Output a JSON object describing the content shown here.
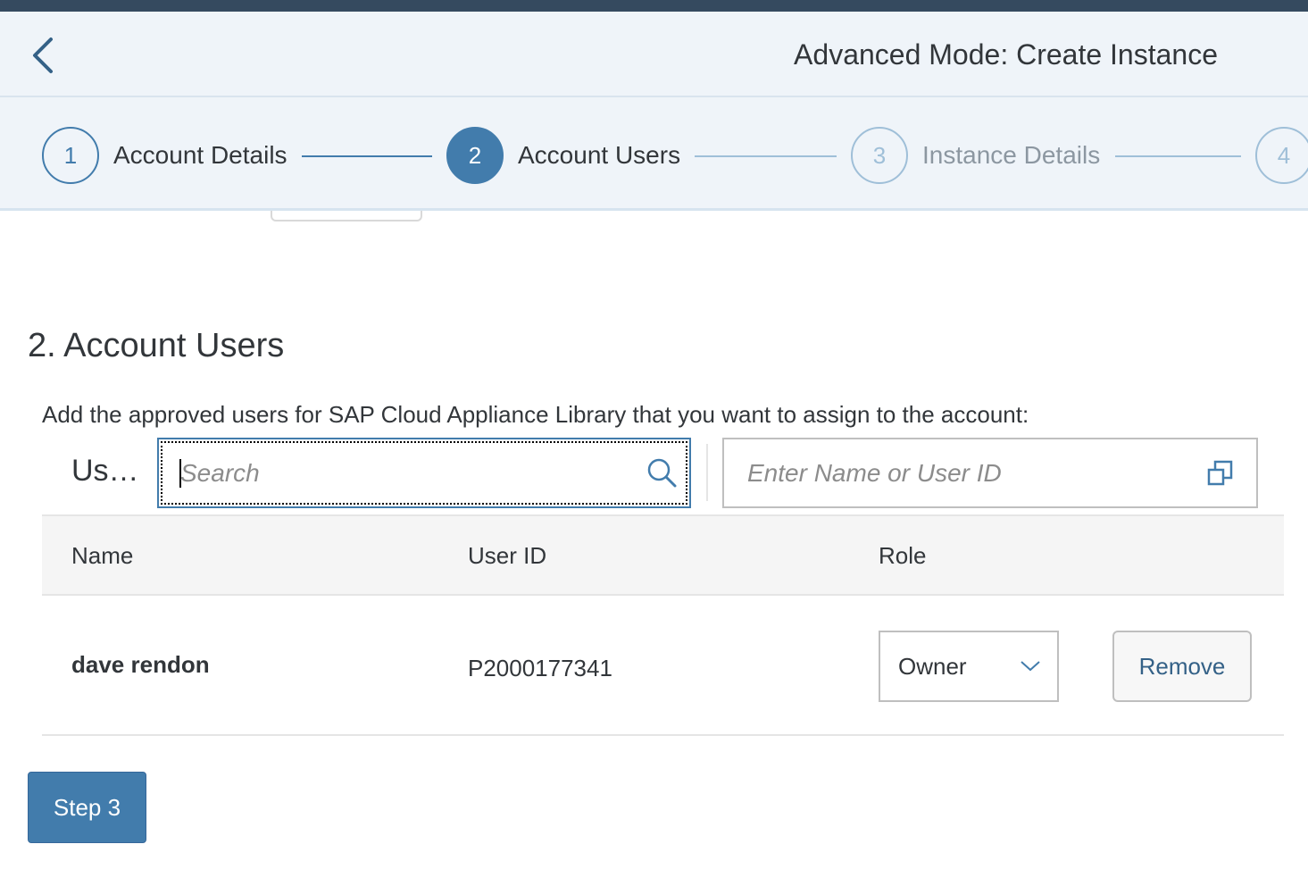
{
  "header": {
    "title": "Advanced Mode: Create Instance",
    "back_icon": "chevron-left-icon"
  },
  "wizard": {
    "steps": [
      {
        "number": "1",
        "label": "Account Details",
        "state": "completed"
      },
      {
        "number": "2",
        "label": "Account Users",
        "state": "active"
      },
      {
        "number": "3",
        "label": "Instance Details",
        "state": "disabled"
      },
      {
        "number": "4",
        "label": "",
        "state": "disabled"
      }
    ]
  },
  "section": {
    "title": "2. Account Users",
    "instructions": "Add the approved users for SAP Cloud Appliance Library that you want to assign to the account:"
  },
  "toolbar": {
    "label": "Us…",
    "search_placeholder": "Search",
    "search_value": "",
    "value_help_placeholder": "Enter Name or User ID",
    "value_help_value": ""
  },
  "table": {
    "columns": [
      "Name",
      "User ID",
      "Role"
    ],
    "rows": [
      {
        "name": "dave rendon",
        "user_id": "P2000177341",
        "role": "Owner",
        "action": "Remove"
      }
    ]
  },
  "footer": {
    "next_label": "Step 3"
  },
  "colors": {
    "accent": "#427cac",
    "shell": "#354a5f",
    "header_bg": "#eff4f9"
  }
}
